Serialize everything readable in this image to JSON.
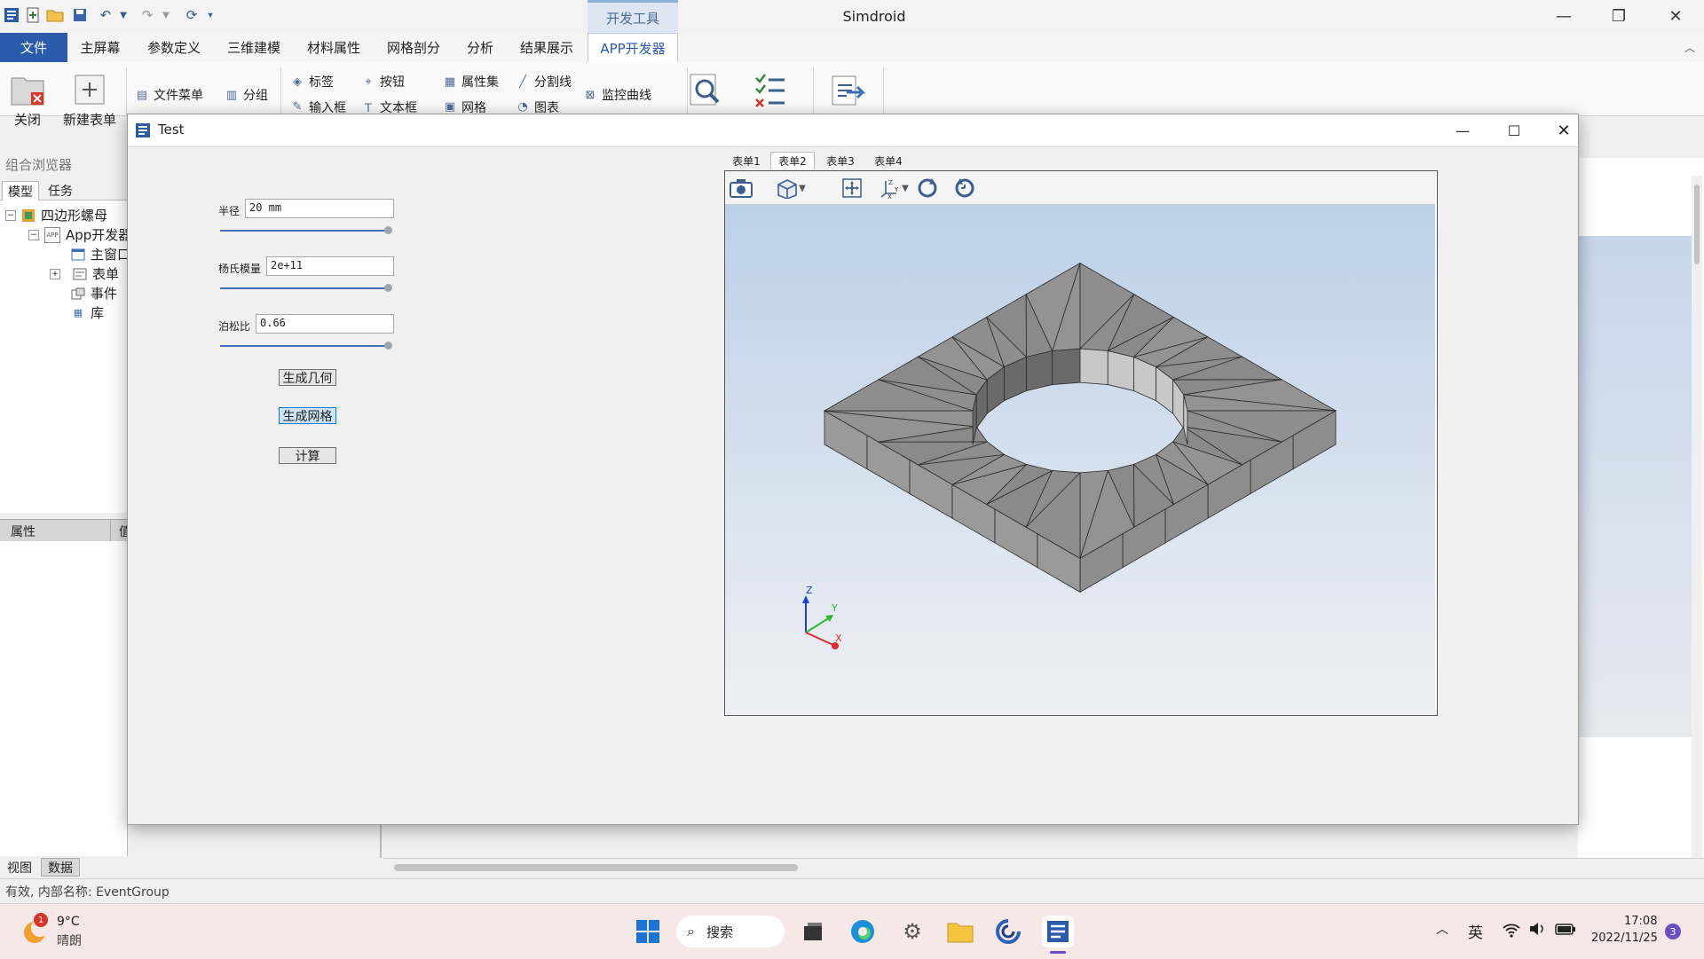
{
  "window": {
    "title": "Simdroid",
    "context_tab": "开发工具",
    "min_icon": "—",
    "restore_icon": "❐",
    "close_icon": "✕"
  },
  "ribbon": {
    "tabs": [
      "文件",
      "主屏幕",
      "参数定义",
      "三维建模",
      "材料属性",
      "网格剖分",
      "分析",
      "结果展示",
      "APP开发器"
    ],
    "active_tab": "APP开发器",
    "big_buttons": [
      {
        "label": "关闭",
        "icon": "close-folder-icon"
      },
      {
        "label": "新建表单",
        "icon": "new-form-icon"
      }
    ],
    "small_buttons": {
      "file_menu": "文件菜单",
      "group": "分组",
      "label": "标签",
      "button": "按钮",
      "input": "输入框",
      "textbox": "文本框",
      "property_set": "属性集",
      "splitter": "分割线",
      "mesh": "网格",
      "chart": "图表",
      "monitor_curve": "监控曲线"
    }
  },
  "browser": {
    "title": "组合浏览器",
    "tabs": [
      "模型",
      "任务"
    ],
    "tree": {
      "root": "四边形螺母",
      "app": "App开发器",
      "main_window": "主窗口",
      "form": "表单",
      "event": "事件",
      "library": "库"
    },
    "property_header": "属性",
    "property_value_col": "值"
  },
  "dialog": {
    "title": "Test",
    "fields": [
      {
        "label": "半径",
        "value": "20 mm"
      },
      {
        "label": "杨氏模量",
        "value": "2e+11"
      },
      {
        "label": "泊松比",
        "value": "0.66"
      }
    ],
    "buttons": [
      "生成几何",
      "生成网格",
      "计算"
    ],
    "form_tabs": [
      "表单1",
      "表单2",
      "表单3",
      "表单4"
    ],
    "active_form_tab": "表单2",
    "axis_labels": {
      "x": "X",
      "y": "Y",
      "z": "Z"
    }
  },
  "bottom_tabs": [
    "视图",
    "数据"
  ],
  "active_bottom_tab": "数据",
  "status_text": "有效, 内部名称: EventGroup",
  "taskbar": {
    "weather_temp": "9°C",
    "weather_desc": "晴朗",
    "weather_badge": "1",
    "search_label": "搜索",
    "ime": "英",
    "time": "17:08",
    "date": "2022/11/25",
    "notification_count": "3"
  },
  "colors": {
    "file_tab": "#2b5bab",
    "accent": "#3b6fb6",
    "taskbar": "#f6e8e7",
    "mesh_face": "#8e8e8e",
    "viewport_top": "#bcd0e8"
  }
}
